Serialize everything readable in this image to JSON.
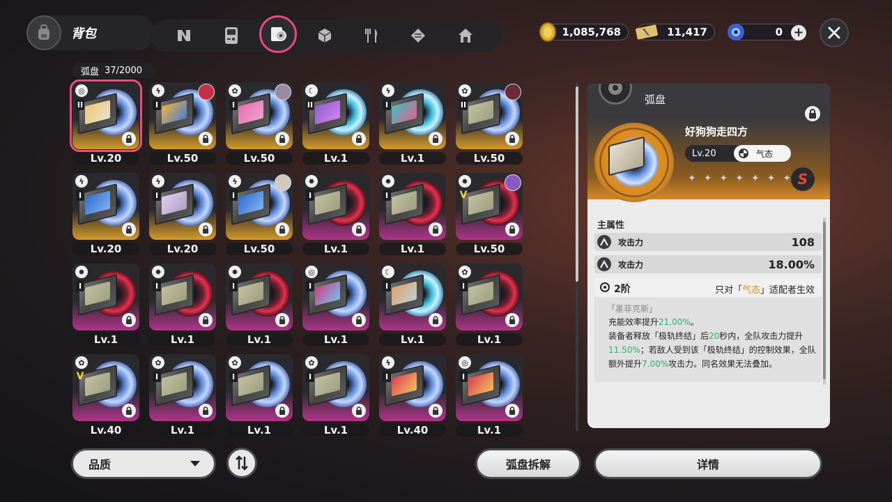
{
  "header": {
    "title": "背包",
    "tabs": [
      {
        "icon": "n-logo-icon"
      },
      {
        "icon": "handheld-console-icon"
      },
      {
        "icon": "disc-drive-icon",
        "active": true
      },
      {
        "icon": "cube-icon"
      },
      {
        "icon": "fork-knife-icon"
      },
      {
        "icon": "layers-box-icon"
      },
      {
        "icon": "house-icon"
      }
    ],
    "currencies": [
      {
        "icon": "gold-coin-icon",
        "value": "1,085,768"
      },
      {
        "icon": "ticket-icon",
        "value": "11,417"
      },
      {
        "icon": "blue-orb-icon",
        "value": "0"
      }
    ]
  },
  "inventory": {
    "label": "弧盘",
    "count": "37/2000",
    "items": [
      {
        "attr": "◎",
        "rank": "II",
        "level": "Lv.20",
        "rarity": "gold",
        "disc": "blue",
        "cover": "c1",
        "avatar": null,
        "selected": true
      },
      {
        "attr": "ϟ",
        "rank": "I",
        "level": "Lv.50",
        "rarity": "gold",
        "disc": "blue",
        "cover": "c2",
        "avatar": "#c8304a"
      },
      {
        "attr": "✿",
        "rank": "I",
        "level": "Lv.50",
        "rarity": "gold",
        "disc": "blue",
        "cover": "c3",
        "avatar": "#9a8aa0"
      },
      {
        "attr": "☾",
        "rank": "II",
        "level": "Lv.1",
        "rarity": "gold",
        "disc": "cyan",
        "cover": "c4",
        "avatar": null
      },
      {
        "attr": "ϟ",
        "rank": "I",
        "level": "Lv.1",
        "rarity": "gold",
        "disc": "cyan",
        "cover": "c5",
        "avatar": null
      },
      {
        "attr": "✿",
        "rank": "II",
        "level": "Lv.50",
        "rarity": "gold",
        "disc": "blue",
        "cover": "c6",
        "avatar": "#6a2a3a"
      },
      {
        "attr": "ϟ",
        "rank": "I",
        "level": "Lv.20",
        "rarity": "gold",
        "disc": "blue",
        "cover": "c7",
        "avatar": null
      },
      {
        "attr": "ϟ",
        "rank": "I",
        "level": "Lv.20",
        "rarity": "gold",
        "disc": "blue",
        "cover": "c8",
        "avatar": null
      },
      {
        "attr": "ϟ",
        "rank": "I",
        "level": "Lv.50",
        "rarity": "gold",
        "disc": "blue",
        "cover": "c7",
        "avatar": "#d0c8c0"
      },
      {
        "attr": "✹",
        "rank": "I",
        "level": "Lv.1",
        "rarity": "pink",
        "disc": "red",
        "cover": "c6",
        "avatar": null
      },
      {
        "attr": "✹",
        "rank": "I",
        "level": "Lv.1",
        "rarity": "pink",
        "disc": "red",
        "cover": "c6",
        "avatar": null
      },
      {
        "attr": "✹",
        "rank": "V",
        "level": "Lv.50",
        "rarity": "pink",
        "disc": "red",
        "cover": "c6",
        "avatar": "#8a5ac0"
      },
      {
        "attr": "✹",
        "rank": "I",
        "level": "Lv.1",
        "rarity": "pink",
        "disc": "red",
        "cover": "c6",
        "avatar": null
      },
      {
        "attr": "✹",
        "rank": "I",
        "level": "Lv.1",
        "rarity": "pink",
        "disc": "red",
        "cover": "c6",
        "avatar": null
      },
      {
        "attr": "✹",
        "rank": "I",
        "level": "Lv.1",
        "rarity": "pink",
        "disc": "red",
        "cover": "c6",
        "avatar": null
      },
      {
        "attr": "◎",
        "rank": "I",
        "level": "Lv.1",
        "rarity": "pink",
        "disc": "blue",
        "cover": "c9",
        "avatar": null
      },
      {
        "attr": "☾",
        "rank": "I",
        "level": "Lv.1",
        "rarity": "pink",
        "disc": "cyan",
        "cover": "c10",
        "avatar": null
      },
      {
        "attr": "✿",
        "rank": "I",
        "level": "Lv.1",
        "rarity": "pink",
        "disc": "red",
        "cover": "c6",
        "avatar": null
      },
      {
        "attr": "✿",
        "rank": "V",
        "level": "Lv.40",
        "rarity": "pink",
        "disc": "blue",
        "cover": "c6",
        "avatar": null
      },
      {
        "attr": "✿",
        "rank": "I",
        "level": "Lv.1",
        "rarity": "pink",
        "disc": "blue",
        "cover": "c6",
        "avatar": null
      },
      {
        "attr": "✿",
        "rank": "I",
        "level": "Lv.1",
        "rarity": "pink",
        "disc": "blue",
        "cover": "c6",
        "avatar": null
      },
      {
        "attr": "✿",
        "rank": "I",
        "level": "Lv.1",
        "rarity": "pink",
        "disc": "blue",
        "cover": "c6",
        "avatar": null
      },
      {
        "attr": "ϟ",
        "rank": "I",
        "level": "Lv.40",
        "rarity": "pink",
        "disc": "blue",
        "cover": "c11",
        "avatar": null
      },
      {
        "attr": "◎",
        "rank": "I",
        "level": "Lv.1",
        "rarity": "pink",
        "disc": "blue",
        "cover": "c11",
        "avatar": null
      }
    ]
  },
  "detail": {
    "category": "弧盘",
    "name": "好狗狗走四方",
    "level": "Lv.20",
    "type": "气态",
    "stars": [
      "✦",
      "✦",
      "✦",
      "✦",
      "✦",
      "✦",
      "✦"
    ],
    "rank_badge": "S",
    "main_attr_label": "主属性",
    "stats": [
      {
        "name": "攻击力",
        "value": "108"
      },
      {
        "name": "攻击力",
        "value": "18.00%"
      }
    ],
    "set": {
      "tier": "2阶",
      "cond_prefix": "只对「",
      "cond_type": "气态",
      "cond_suffix": "」适配者生效",
      "name": "「墨菲克斯」",
      "line1_a": "充能效率提升",
      "line1_b": "21.00%",
      "line1_c": "。",
      "line2_a": "装备者释放「极轨终结」后",
      "line2_b": "20",
      "line2_c": "秒内，全队攻击力提升",
      "line2_d": "11.50%",
      "line2_e": "；若敌人受到该「极轨终结」的控制效果，全队额外提升",
      "line2_f": "7.00%",
      "line2_g": "攻击力。同名效果无法叠加。"
    }
  },
  "buttons": {
    "quality": "品质",
    "dismantle": "弧盘拆解",
    "details": "详情"
  },
  "colors": {
    "accent_pink": "#e84a83",
    "gold_rarity": "#d49a2a",
    "pink_rarity": "#b0348a",
    "highlight_green": "#2ab06a",
    "highlight_orange": "#e88a1a"
  }
}
